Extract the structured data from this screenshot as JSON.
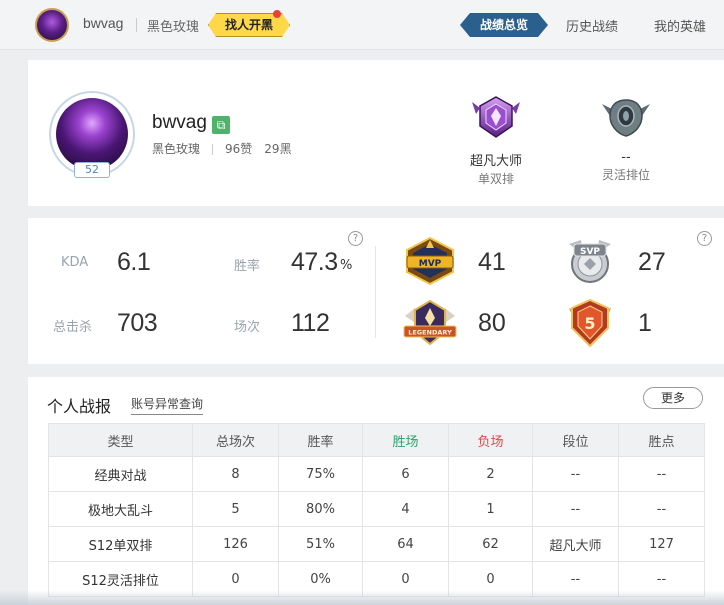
{
  "topbar": {
    "username": "bwvag",
    "server": "黑色玫瑰",
    "blacklist_button": "找人开黑",
    "tabs": [
      {
        "label": "战绩总览",
        "active": true
      },
      {
        "label": "历史战绩",
        "active": false
      },
      {
        "label": "我的英雄",
        "active": false
      }
    ]
  },
  "profile": {
    "name": "bwvag",
    "level": "52",
    "server": "黑色玫瑰",
    "likes": "96赞",
    "blacks": "29黑",
    "ranks": [
      {
        "tier": "超凡大师",
        "queue": "单双排",
        "icon": "master-rank-emblem-icon"
      },
      {
        "tier": "--",
        "queue": "灵活排位",
        "icon": "unranked-emblem-icon"
      }
    ]
  },
  "stats": {
    "kda_label": "KDA",
    "kda_value": "6.1",
    "winrate_label": "胜率",
    "winrate_value": "47.3",
    "winrate_unit": "%",
    "kills_label": "总击杀",
    "kills_value": "703",
    "games_label": "场次",
    "games_value": "112",
    "help": "?",
    "medals": [
      {
        "name": "MVP",
        "count": "41"
      },
      {
        "name": "SVP",
        "count": "27"
      },
      {
        "name": "LEGENDARY",
        "count": "80"
      },
      {
        "name": "5",
        "count": "1"
      }
    ]
  },
  "report": {
    "title": "个人战报",
    "link": "账号异常查询",
    "more": "更多",
    "columns": [
      "类型",
      "总场次",
      "胜率",
      "胜场",
      "负场",
      "段位",
      "胜点"
    ],
    "rows": [
      [
        "经典对战",
        "8",
        "75%",
        "6",
        "2",
        "--",
        "--"
      ],
      [
        "极地大乱斗",
        "5",
        "80%",
        "4",
        "1",
        "--",
        "--"
      ],
      [
        "S12单双排",
        "126",
        "51%",
        "64",
        "62",
        "超凡大师",
        "127"
      ],
      [
        "S12灵活排位",
        "0",
        "0%",
        "0",
        "0",
        "--",
        "--"
      ]
    ]
  },
  "colors": {
    "accent": "#2b5f8e",
    "blacklist": "#ffd84a",
    "win": "#2aa36d",
    "loss": "#e04a4a"
  }
}
